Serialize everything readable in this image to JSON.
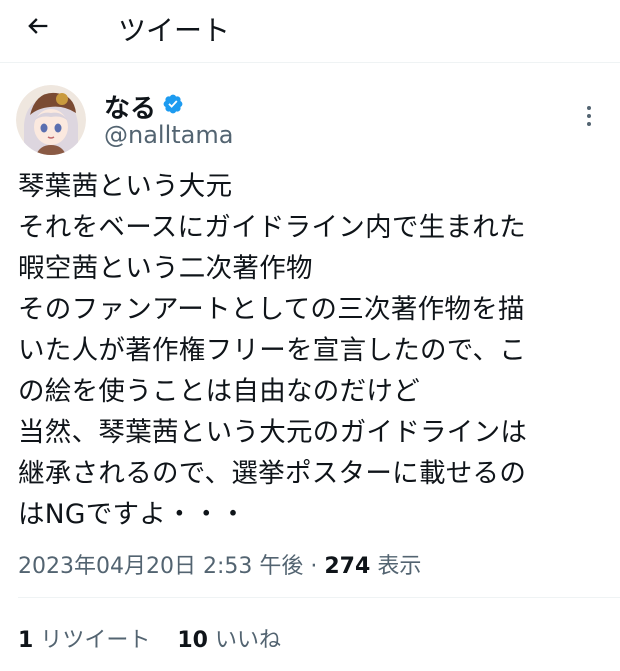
{
  "header": {
    "title": "ツイート"
  },
  "author": {
    "name": "なる",
    "handle": "@nalltama"
  },
  "tweet": {
    "lines": [
      "琴葉茜という大元",
      "それをベースにガイドライン内で生まれた",
      "暇空茜という二次著作物",
      "そのファンアートとしての三次著作物を描",
      "いた人が著作権フリーを宣言したので、こ",
      "の絵を使うことは自由なのだけど",
      "当然、琴葉茜という大元のガイドラインは",
      "継承されるので、選挙ポスターに載せるの",
      "はNGですよ・・・"
    ]
  },
  "meta": {
    "timestamp": "2023年04月20日 2:53 午後",
    "separator": "·",
    "views_count": "274",
    "views_label": "表示"
  },
  "stats": {
    "retweets_count": "1",
    "retweets_label": "リツイート",
    "likes_count": "10",
    "likes_label": "いいね"
  },
  "colors": {
    "text": "#0f1419",
    "secondary": "#536471",
    "verified": "#1d9bf0"
  },
  "icons": {
    "back": "arrow-left-icon",
    "verified": "verified-badge-icon",
    "more": "more-vertical-icon"
  }
}
